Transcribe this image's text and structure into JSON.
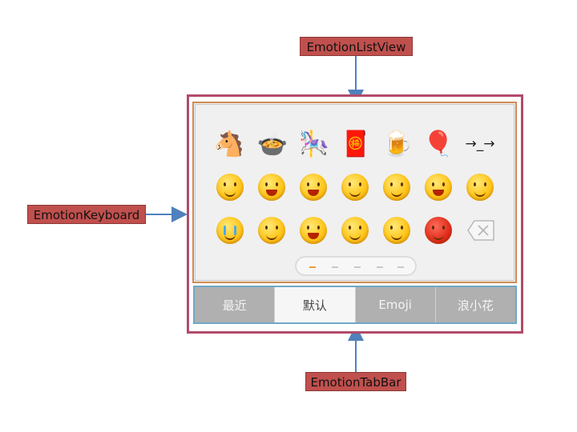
{
  "callouts": {
    "listview": "EmotionListView",
    "keyboard": "EmotionKeyboard",
    "tabbar": "EmotionTabBar"
  },
  "colors": {
    "callout_bg": "#c0504d",
    "keyboard_border": "#b24b6a",
    "listview_border": "#d08b52",
    "tabbar_border": "#6fa8c8",
    "arrow": "#4f81bd",
    "active_page_dot": "#f09a3c"
  },
  "emotion_grid": {
    "row1": [
      "horse-emoji",
      "rice-dumpling-bowl-emoji",
      "rocking-horse-emoji",
      "red-envelope-emoji",
      "beer-and-ingot-emoji",
      "hot-air-balloon-emoji",
      "→_→"
    ],
    "row2": [
      "smile-face",
      "grin-face",
      "laugh-face",
      "kiss-heart-face",
      "shy-face",
      "surprised-face",
      "dizzy-face"
    ],
    "row3": [
      "crying-face",
      "tongue-face",
      "yawn-face",
      "annoyed-face",
      "pout-face",
      "angry-face",
      "delete-icon"
    ],
    "arrow_text": "→_→"
  },
  "pager": {
    "page_count": 5,
    "active_index": 0
  },
  "tabbar": {
    "tabs": [
      {
        "label": "最近",
        "selected": false
      },
      {
        "label": "默认",
        "selected": true
      },
      {
        "label": "Emoji",
        "selected": false
      },
      {
        "label": "浪小花",
        "selected": false
      }
    ]
  }
}
